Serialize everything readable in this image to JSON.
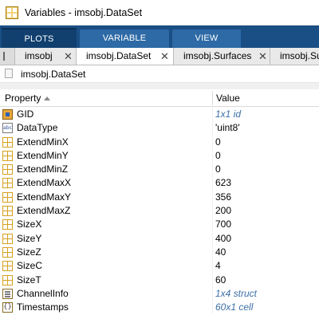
{
  "window": {
    "title": "Variables - imsobj.DataSet"
  },
  "ribbon": {
    "tabs": [
      "PLOTS",
      "VARIABLE",
      "VIEW"
    ]
  },
  "doc_tabs": [
    {
      "label": "imsobj"
    },
    {
      "label": "imsobj.DataSet"
    },
    {
      "label": "imsobj.Surfaces"
    },
    {
      "label": "imsobj.Su"
    }
  ],
  "path": "imsobj.DataSet",
  "table": {
    "columns": [
      "Property",
      "Value"
    ],
    "rows": [
      {
        "property": "GID",
        "value": "1x1 id",
        "icon": "object-icon",
        "link": true
      },
      {
        "property": "DataType",
        "value": "'uint8'",
        "icon": "char-icon",
        "link": false
      },
      {
        "property": "ExtendMinX",
        "value": "0",
        "icon": "numeric-grid-icon",
        "link": false
      },
      {
        "property": "ExtendMinY",
        "value": "0",
        "icon": "numeric-grid-icon",
        "link": false
      },
      {
        "property": "ExtendMinZ",
        "value": "0",
        "icon": "numeric-grid-icon",
        "link": false
      },
      {
        "property": "ExtendMaxX",
        "value": "623",
        "icon": "numeric-grid-icon",
        "link": false
      },
      {
        "property": "ExtendMaxY",
        "value": "356",
        "icon": "numeric-grid-icon",
        "link": false
      },
      {
        "property": "ExtendMaxZ",
        "value": "200",
        "icon": "numeric-grid-icon",
        "link": false
      },
      {
        "property": "SizeX",
        "value": "700",
        "icon": "numeric-grid-icon",
        "link": false
      },
      {
        "property": "SizeY",
        "value": "400",
        "icon": "numeric-grid-icon",
        "link": false
      },
      {
        "property": "SizeZ",
        "value": "40",
        "icon": "numeric-grid-icon",
        "link": false
      },
      {
        "property": "SizeC",
        "value": "4",
        "icon": "numeric-grid-icon",
        "link": false
      },
      {
        "property": "SizeT",
        "value": "60",
        "icon": "numeric-grid-icon",
        "link": false
      },
      {
        "property": "ChannelInfo",
        "value": "1x4 struct",
        "icon": "struct-icon",
        "link": true
      },
      {
        "property": "Timestamps",
        "value": "60x1 cell",
        "icon": "cell-icon",
        "link": true
      }
    ]
  },
  "colors": {
    "ribbon": "#1a4f85",
    "link": "#3b6fa6"
  }
}
